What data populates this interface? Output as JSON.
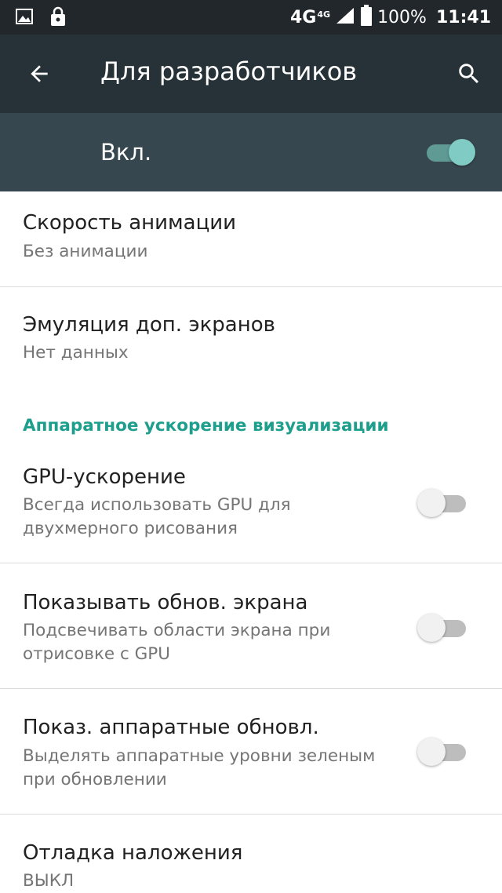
{
  "status_bar": {
    "left_icons": [
      "image-icon",
      "lock-icon"
    ],
    "network": "4G",
    "network_sub": "4G",
    "battery_percent": "100%",
    "time": "11:41"
  },
  "app_bar": {
    "title": "Для разработчиков",
    "back_icon": "arrow-back-icon",
    "search_icon": "search-icon"
  },
  "master_switch": {
    "label": "Вкл.",
    "on": true,
    "colors": {
      "track": "#5f9a94",
      "thumb": "#80cbc4"
    }
  },
  "items": [
    {
      "title": "Скорость анимации",
      "summary": "Без анимации"
    },
    {
      "title": "Эмуляция доп. экранов",
      "summary": "Нет данных"
    }
  ],
  "section": {
    "header": "Аппаратное ускорение визуализации",
    "color": "#1e9e8c"
  },
  "toggle_items": [
    {
      "title": "GPU-ускорение",
      "summary_line1": "Всегда использовать GPU для",
      "summary_line2": "двухмерного рисования",
      "on": false
    },
    {
      "title": "Показывать обнов. экрана",
      "summary_line1": "Подсвечивать области экрана при",
      "summary_line2": "отрисовке с GPU",
      "on": false
    },
    {
      "title": "Показ. аппаратные обновл.",
      "summary_line1": "Выделять аппаратные уровни зеленым",
      "summary_line2": "при обновлении",
      "on": false
    }
  ],
  "last_item": {
    "title": "Отладка наложения",
    "summary": "ВЫКЛ"
  }
}
